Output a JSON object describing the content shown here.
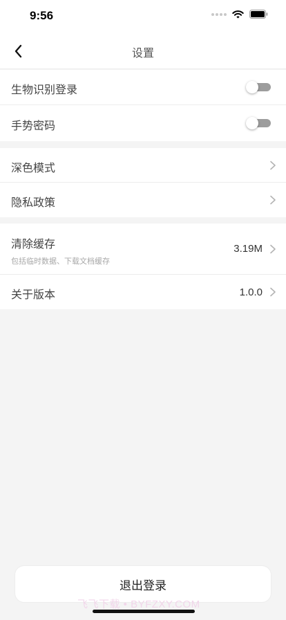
{
  "status": {
    "time": "9:56"
  },
  "nav": {
    "title": "设置"
  },
  "security": {
    "biometric_label": "生物识别登录",
    "biometric_on": false,
    "gesture_label": "手势密码",
    "gesture_on": false
  },
  "general": {
    "dark_mode_label": "深色模式",
    "privacy_label": "隐私政策"
  },
  "storage": {
    "clear_cache_label": "清除缓存",
    "clear_cache_desc": "包括临时数据、下载文档缓存",
    "cache_size": "3.19M",
    "about_label": "关于版本",
    "version": "1.0.0"
  },
  "logout_label": "退出登录",
  "watermark": "飞飞下载 • BYFZXY.COM",
  "colors": {
    "toggle_off": "#9d9d9d",
    "background": "#f4f4f4"
  }
}
